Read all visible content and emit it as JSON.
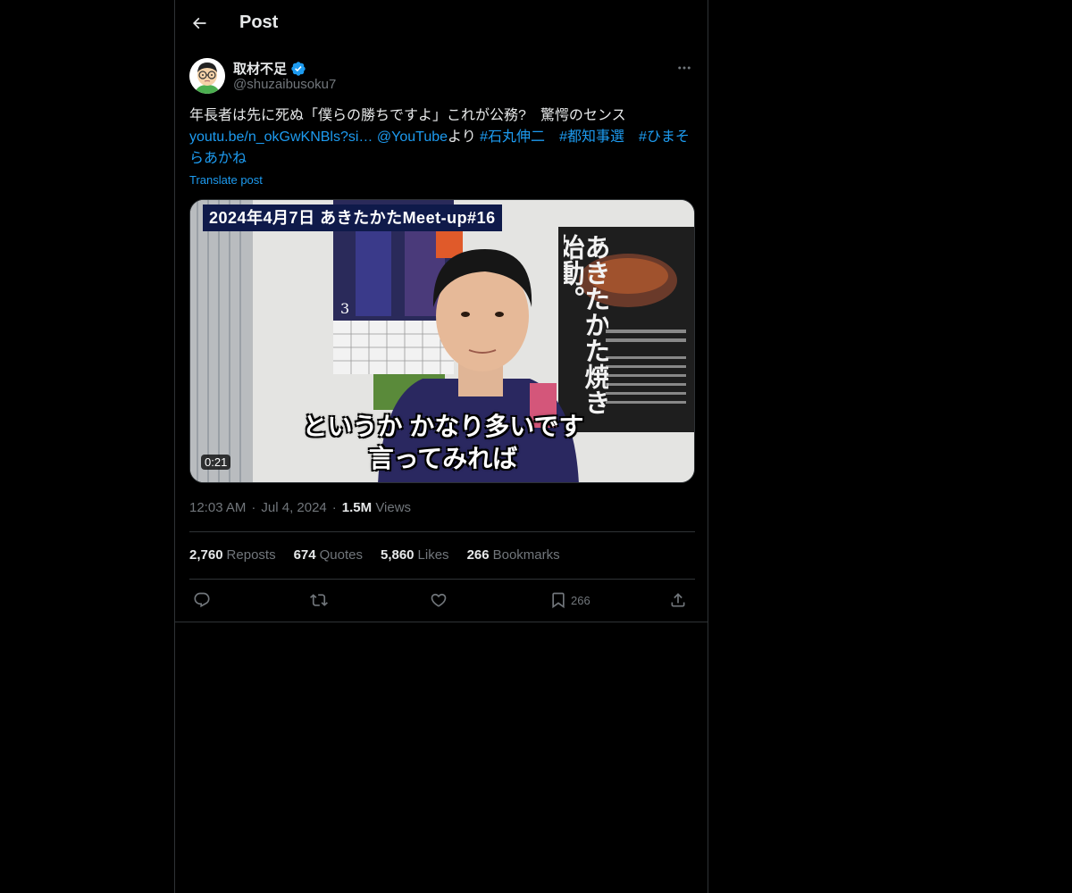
{
  "header": {
    "title": "Post",
    "back_icon": "arrow-left-icon"
  },
  "author": {
    "name": "取材不足",
    "handle": "@shuzaibusoku7",
    "verified": true,
    "verified_color": "#1d9bf0"
  },
  "tweet": {
    "line1": "年長者は先に死ぬ「僕らの勝ちですよ」これが公務?　驚愕のセンス",
    "link_text": "youtu.be/n_okGwKNBls?si…",
    "mention": "@YouTube",
    "yori": "より",
    "hashtag1": "#石丸伸二",
    "hashtag2": "#都知事選",
    "hashtag3": "#ひまそらあかね",
    "translate_label": "Translate post"
  },
  "media": {
    "banner": "2024年4月7日 あきたかたMeet-up#16",
    "subtitle_line1": "というか かなり多いです",
    "subtitle_line2": "言ってみれば",
    "poster_text": "あきたかた焼き始動。",
    "calendar_number": "3",
    "duration": "0:21"
  },
  "meta": {
    "time": "12:03 AM",
    "separator": "·",
    "date": "Jul 4, 2024",
    "views_count": "1.5M",
    "views_label": "Views"
  },
  "stats": {
    "reposts_count": "2,760",
    "reposts_label": "Reposts",
    "quotes_count": "674",
    "quotes_label": "Quotes",
    "likes_count": "5,860",
    "likes_label": "Likes",
    "bookmarks_count": "266",
    "bookmarks_label": "Bookmarks"
  },
  "actions": {
    "reply_icon": "reply-icon",
    "repost_icon": "repost-icon",
    "like_icon": "heart-icon",
    "bookmark_icon": "bookmark-icon",
    "bookmark_count": "266",
    "share_icon": "share-icon"
  },
  "colors": {
    "background": "#000000",
    "text": "#e7e9ea",
    "secondary": "#71767b",
    "accent": "#1d9bf0",
    "border": "#2f3336"
  }
}
